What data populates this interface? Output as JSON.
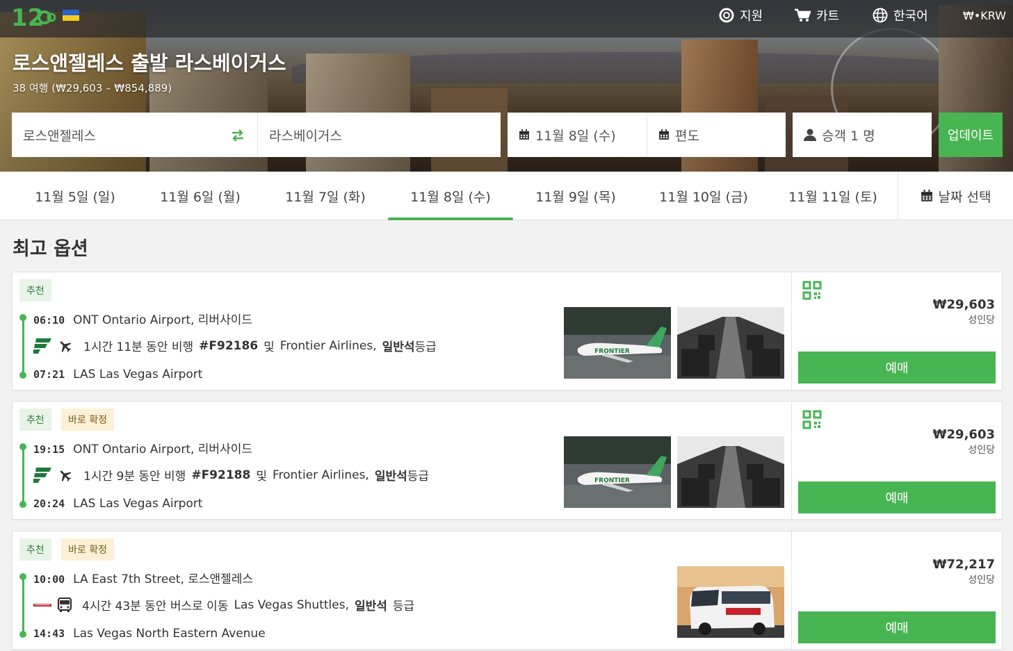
{
  "nav": {
    "support": "지원",
    "cart": "카트",
    "language": "한국어",
    "currency": "₩•KRW"
  },
  "hero": {
    "title": "로스앤젤레스 출발 라스베이거스",
    "subtitle": "38 여행 (₩29,603 – ₩854,889)"
  },
  "search": {
    "from": "로스앤젤레스",
    "to": "라스베이거스",
    "date": "11월 8일 (수)",
    "return": "편도",
    "passengers": "승객 1 명",
    "update_label": "업데이트"
  },
  "date_tabs": [
    {
      "label": "11월 5일 (일)"
    },
    {
      "label": "11월 6일 (월)"
    },
    {
      "label": "11월 7일 (화)"
    },
    {
      "label": "11월 8일 (수)",
      "active": true
    },
    {
      "label": "11월 9일 (목)"
    },
    {
      "label": "11월 10일 (금)"
    },
    {
      "label": "11월 11일 (토)"
    }
  ],
  "date_picker_label": "날짜 선택",
  "section_title": "최고 옵션",
  "trips": [
    {
      "badges": [
        "추천"
      ],
      "depart_time": "06:10",
      "depart_place": "ONT Ontario Airport, 리버사이드",
      "duration_text": "1시간 11분 동안 비행",
      "code": "#F92186",
      "and": "및",
      "operator": "Frontier Airlines,",
      "class": "일반석",
      "class_suffix": "등급",
      "arrive_time": "07:21",
      "arrive_place": "LAS Las Vegas Airport",
      "price": "₩29,603",
      "per": "성인당",
      "book": "예매",
      "mode": "flight"
    },
    {
      "badges": [
        "추천",
        "바로 확정"
      ],
      "depart_time": "19:15",
      "depart_place": "ONT Ontario Airport, 리버사이드",
      "duration_text": "1시간 9분 동안 비행",
      "code": "#F92188",
      "and": "및",
      "operator": "Frontier Airlines,",
      "class": "일반석",
      "class_suffix": "등급",
      "arrive_time": "20:24",
      "arrive_place": "LAS Las Vegas Airport",
      "price": "₩29,603",
      "per": "성인당",
      "book": "예매",
      "mode": "flight"
    },
    {
      "badges": [
        "추천",
        "바로 확정"
      ],
      "depart_time": "10:00",
      "depart_place": "LA East 7th Street, 로스앤젤레스",
      "duration_text": "4시간 43분 동안 버스로 이동",
      "operator": "Las Vegas Shuttles,",
      "class": "일반석",
      "class_suffix": "등급",
      "arrive_time": "14:43",
      "arrive_place": "Las Vegas North Eastern Avenue",
      "price": "₩72,217",
      "per": "성인당",
      "book": "예매",
      "mode": "bus"
    }
  ],
  "colors": {
    "accent": "#48b553",
    "badge_recommend_bg": "#e7f4e7",
    "badge_instant_bg": "#fdf0d6"
  },
  "icons": {
    "logo": "12go-logo-icon",
    "flag": "ukraine-flag-icon",
    "support": "lifebuoy-icon",
    "cart": "cart-icon",
    "language": "globe-icon",
    "swap": "swap-arrows-icon",
    "calendar": "calendar-icon",
    "user": "user-icon",
    "qr": "qr-code-icon",
    "plane": "plane-icon",
    "bus": "bus-icon"
  }
}
